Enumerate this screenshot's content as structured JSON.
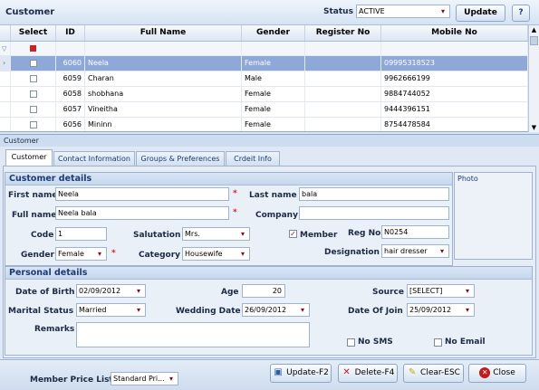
{
  "header": {
    "title": "Customer",
    "status_label": "Status",
    "status_value": "ACTIVE",
    "update_label": "Update",
    "help_icon": "help-icon"
  },
  "grid": {
    "columns": [
      "Select",
      "ID",
      "Full Name",
      "Gender",
      "Register No",
      "Mobile No"
    ],
    "rows": [
      {
        "id": "6060",
        "name": "Neela",
        "gender": "Female",
        "reg": "",
        "mobile": "09995318523",
        "selected": true
      },
      {
        "id": "6059",
        "name": "Charan",
        "gender": "Male",
        "reg": "",
        "mobile": "9962666199",
        "selected": false
      },
      {
        "id": "6058",
        "name": "shobhana",
        "gender": "Female",
        "reg": "",
        "mobile": "9884744052",
        "selected": false
      },
      {
        "id": "6057",
        "name": "Vineitha",
        "gender": "Female",
        "reg": "",
        "mobile": "9444396151",
        "selected": false
      },
      {
        "id": "6056",
        "name": "Mininn",
        "gender": "Female",
        "reg": "",
        "mobile": "8754478584",
        "selected": false
      }
    ]
  },
  "panel": {
    "title": "Customer",
    "tabs": [
      "Customer",
      "Contact Information",
      "Groups & Preferences",
      "Crdeit Info"
    ]
  },
  "customer_details": {
    "title": "Customer details",
    "first_name_label": "First name",
    "first_name": "Neela",
    "last_name_label": "Last name",
    "last_name": "bala",
    "full_name_label": "Full name",
    "full_name": "Neela bala",
    "company_label": "Company",
    "company": "",
    "code_label": "Code",
    "code": "1",
    "salutation_label": "Salutation",
    "salutation": "Mrs.",
    "member_label": "Member",
    "reg_no_label": "Reg No",
    "reg_no": "N0254",
    "gender_label": "Gender",
    "gender": "Female",
    "category_label": "Category",
    "category": "Housewife",
    "designation_label": "Designation",
    "designation": "hair dresser",
    "photo_label": "Photo"
  },
  "personal_details": {
    "title": "Personal details",
    "dob_label": "Date of Birth",
    "dob": "02/09/2012",
    "age_label": "Age",
    "age": "20",
    "source_label": "Source",
    "source": "[SELECT]",
    "marital_label": "Marital Status",
    "marital": "Married",
    "wedding_label": "Wedding Date",
    "wedding": "26/09/2012",
    "doj_label": "Date Of Join",
    "doj": "25/09/2012",
    "remarks_label": "Remarks",
    "remarks": "",
    "no_sms_label": "No SMS",
    "no_email_label": "No Email"
  },
  "footer": {
    "price_list_label": "Member Price List",
    "price_list": "Standard Pri...",
    "update_f2": "Update-F2",
    "delete_f4": "Delete-F4",
    "clear_esc": "Clear-ESC",
    "close": "Close"
  }
}
